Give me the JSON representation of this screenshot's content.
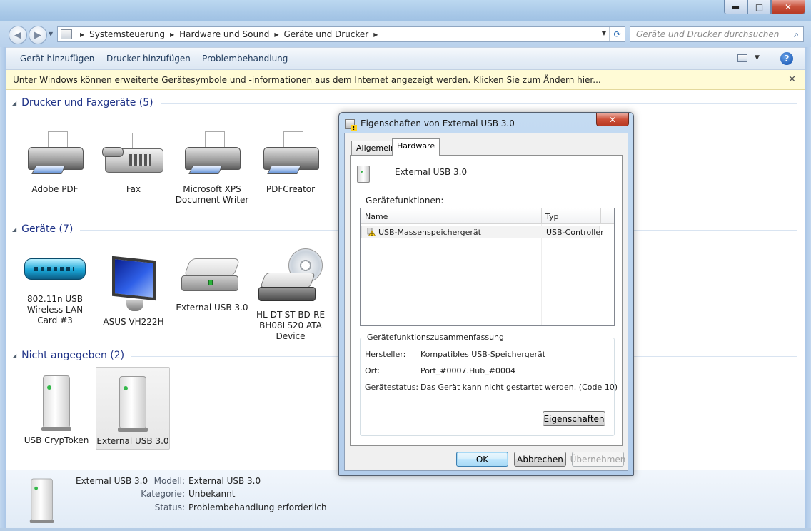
{
  "window": {
    "caption_buttons": {
      "minimize": "▬",
      "maximize": "□",
      "close": "✕"
    }
  },
  "address": {
    "breadcrumb": [
      "Systemsteuerung",
      "Hardware und Sound",
      "Geräte und Drucker"
    ],
    "search_placeholder": "Geräte und Drucker durchsuchen"
  },
  "toolbar": {
    "items": [
      "Gerät hinzufügen",
      "Drucker hinzufügen",
      "Problembehandlung"
    ],
    "help": "?"
  },
  "infobar": {
    "text": "Unter Windows können erweiterte Gerätesymbole und -informationen aus dem Internet angezeigt werden. Klicken Sie zum Ändern hier...",
    "close": "✕"
  },
  "groups": [
    {
      "title": "Drucker und Faxgeräte (5)",
      "devices": [
        "Adobe PDF",
        "Fax",
        "Microsoft XPS Document Writer",
        "PDFCreator"
      ]
    },
    {
      "title": "Geräte (7)",
      "devices": [
        "802.11n USB Wireless LAN Card #3",
        "ASUS VH222H",
        "External USB 3.0",
        "HL-DT-ST BD-RE BH08LS20 ATA Device"
      ]
    },
    {
      "title": "Nicht angegeben (2)",
      "devices": [
        "USB CrypToken",
        "External USB 3.0"
      ]
    }
  ],
  "details": {
    "name": "External USB 3.0",
    "rows": [
      {
        "label": "Modell:",
        "value": "External USB 3.0"
      },
      {
        "label": "Kategorie:",
        "value": "Unbekannt"
      },
      {
        "label": "Status:",
        "value": "Problembehandlung erforderlich"
      }
    ]
  },
  "dialog": {
    "title": "Eigenschaften von External USB 3.0",
    "close": "✕",
    "tabs": [
      "Allgemein",
      "Hardware"
    ],
    "active_tab": "Hardware",
    "device_name": "External USB 3.0",
    "functions_label": "Gerätefunktionen:",
    "columns": [
      "Name",
      "Typ"
    ],
    "rows": [
      {
        "name": "USB-Massenspeichergerät",
        "type": "USB-Controller"
      }
    ],
    "summary_title": "Gerätefunktionszusammenfassung",
    "summary": [
      {
        "label": "Hersteller:",
        "value": "Kompatibles USB-Speichergerät"
      },
      {
        "label": "Ort:",
        "value": "Port_#0007.Hub_#0004"
      },
      {
        "label": "Gerätestatus:",
        "value": "Das Gerät kann nicht gestartet werden. (Code 10)"
      }
    ],
    "properties_button": "Eigenschaften",
    "buttons": {
      "ok": "OK",
      "cancel": "Abbrechen",
      "apply": "Übernehmen"
    }
  }
}
